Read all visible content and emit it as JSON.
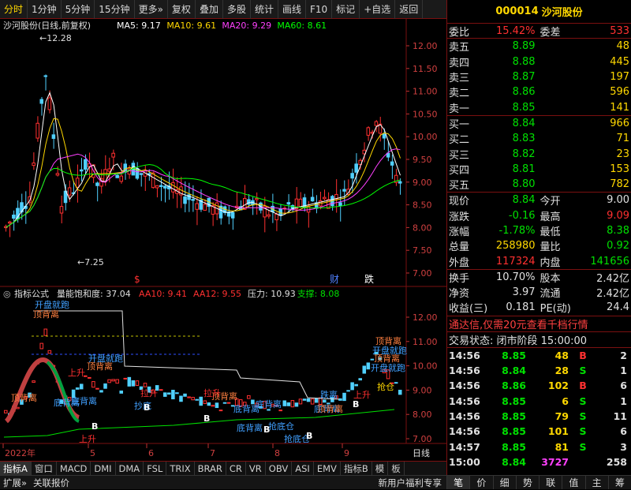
{
  "toolbar": {
    "items": [
      "分时",
      "1分钟",
      "5分钟",
      "15分钟",
      "更多»",
      "复权",
      "叠加",
      "多股",
      "统计",
      "画线",
      "F10",
      "标记",
      "+自选",
      "返回"
    ],
    "active": "分时"
  },
  "main_chart": {
    "title": "沙河股份(日线,前复权)",
    "ma_labels": [
      {
        "text": "MA5: 9.17",
        "color": "#ffffff"
      },
      {
        "text": "MA10: 9.61",
        "color": "#ffd800"
      },
      {
        "text": "MA20: 9.29",
        "color": "#ff40ff"
      },
      {
        "text": "MA60: 8.61",
        "color": "#00ff00"
      }
    ],
    "yaxis": [
      "12.00",
      "11.50",
      "11.00",
      "10.50",
      "10.00",
      "9.50",
      "9.00",
      "8.50",
      "8.00",
      "7.50",
      "7.00"
    ],
    "high_label": "←12.28",
    "low_label": "←7.25",
    "markers": [
      {
        "text": "$",
        "color": "#ff3030"
      },
      {
        "text": "财",
        "color": "#5080ff"
      },
      {
        "text": "跌",
        "color": "#ffffff"
      }
    ]
  },
  "indicator": {
    "name": "指标公式",
    "subtitle": "量能饱和度: 37.04",
    "values": [
      {
        "text": "AA10: 9.41",
        "color": "#ff3030"
      },
      {
        "text": "AA12: 9.55",
        "color": "#ff3030"
      },
      {
        "text": "压力: 10.93",
        "color": "#e0e0e0"
      },
      {
        "text": "支撑: 8.08",
        "color": "#00e000"
      }
    ],
    "yaxis": [
      "12.00",
      "11.00",
      "10.00",
      "9.00",
      "8.00",
      "7.00"
    ],
    "labels": [
      {
        "text": "顶背离",
        "color": "#ff8040"
      },
      {
        "text": "开盘就跑",
        "color": "#40a0ff"
      },
      {
        "text": "顶背离",
        "color": "#ff8040"
      },
      {
        "text": "开盘就跑",
        "color": "#40a0ff"
      },
      {
        "text": "上升",
        "color": "#ff3030"
      },
      {
        "text": "顶背离",
        "color": "#ff8040"
      },
      {
        "text": "底背离",
        "color": "#40a0ff"
      },
      {
        "text": "底背离",
        "color": "#40a0ff"
      },
      {
        "text": "拉升",
        "color": "#ff3030"
      },
      {
        "text": "抄底",
        "color": "#40a0ff"
      },
      {
        "text": "底背离",
        "color": "#40a0ff"
      },
      {
        "text": "抢底仓",
        "color": "#40a0ff"
      },
      {
        "text": "上升",
        "color": "#ff3030"
      },
      {
        "text": "顶背离",
        "color": "#ff8040"
      },
      {
        "text": "底背离",
        "color": "#40a0ff"
      },
      {
        "text": "跌离",
        "color": "#40a0ff"
      },
      {
        "text": "拉升",
        "color": "#ff3030"
      },
      {
        "text": "抢底仓",
        "color": "#40a0ff"
      },
      {
        "text": "顶背离",
        "color": "#ff8040"
      },
      {
        "text": "开盘就跑",
        "color": "#40a0ff"
      },
      {
        "text": "顶背离",
        "color": "#ff8040"
      },
      {
        "text": "开盘就跑",
        "color": "#40a0ff"
      },
      {
        "text": "上升",
        "color": "#ff3030"
      },
      {
        "text": "抢仓",
        "color": "#ffd800"
      },
      {
        "text": "底背离",
        "color": "#40a0ff"
      },
      {
        "text": "底背离",
        "color": "#40a0ff"
      },
      {
        "text": "顶背离",
        "color": "#ff8040"
      },
      {
        "text": "B",
        "color": "#ffffff"
      },
      {
        "text": "B",
        "color": "#ffffff"
      },
      {
        "text": "B",
        "color": "#ffffff"
      },
      {
        "text": "B",
        "color": "#ffffff"
      },
      {
        "text": "B",
        "color": "#ffffff"
      },
      {
        "text": "B",
        "color": "#ffffff"
      }
    ]
  },
  "date_axis": {
    "labels": [
      "2022年",
      "5",
      "6",
      "7",
      "8",
      "9"
    ],
    "period": "日线"
  },
  "bottom_tabs": [
    "指标A",
    "窗口",
    "MACD",
    "DMI",
    "DMA",
    "FSL",
    "TRIX",
    "BRAR",
    "CR",
    "VR",
    "OBV",
    "ASI",
    "EMV",
    "",
    "指标B",
    "模",
    "板"
  ],
  "status": {
    "left": [
      "扩展»",
      "关联报价"
    ],
    "right": "新用户福利专享"
  },
  "quote": {
    "code": "000014",
    "name": "沙河股份",
    "weibi": {
      "label": "委比",
      "value": "15.42%",
      "label2": "委差",
      "value2": "533"
    },
    "asks": [
      {
        "label": "卖五",
        "price": "8.89",
        "vol": "48"
      },
      {
        "label": "卖四",
        "price": "8.88",
        "vol": "445"
      },
      {
        "label": "卖三",
        "price": "8.87",
        "vol": "197"
      },
      {
        "label": "卖二",
        "price": "8.86",
        "vol": "596"
      },
      {
        "label": "卖一",
        "price": "8.85",
        "vol": "141"
      }
    ],
    "bids": [
      {
        "label": "买一",
        "price": "8.84",
        "vol": "966"
      },
      {
        "label": "买二",
        "price": "8.83",
        "vol": "71"
      },
      {
        "label": "买三",
        "price": "8.82",
        "vol": "23"
      },
      {
        "label": "买四",
        "price": "8.81",
        "vol": "153"
      },
      {
        "label": "买五",
        "price": "8.80",
        "vol": "782"
      }
    ],
    "stats1": [
      {
        "l": "现价",
        "v": "8.84",
        "vc": "#00e000",
        "l2": "今开",
        "v2": "9.00",
        "v2c": "#e0e0e0"
      },
      {
        "l": "涨跌",
        "v": "-0.16",
        "vc": "#00e000",
        "l2": "最高",
        "v2": "9.09",
        "v2c": "#ff3030"
      },
      {
        "l": "涨幅",
        "v": "-1.78%",
        "vc": "#00e000",
        "l2": "最低",
        "v2": "8.38",
        "v2c": "#00e000"
      },
      {
        "l": "总量",
        "v": "258980",
        "vc": "#ffd800",
        "l2": "量比",
        "v2": "0.92",
        "v2c": "#00e000"
      },
      {
        "l": "外盘",
        "v": "117324",
        "vc": "#ff3030",
        "l2": "内盘",
        "v2": "141656",
        "v2c": "#00e000"
      }
    ],
    "stats2": [
      {
        "l": "换手",
        "v": "10.70%",
        "l2": "股本",
        "v2": "2.42亿"
      },
      {
        "l": "净资",
        "v": "3.97",
        "l2": "流通",
        "v2": "2.42亿"
      },
      {
        "l": "收益(三)",
        "v": "0.181",
        "l2": "PE(动)",
        "v2": "24.4"
      }
    ],
    "banner": "通达信,仅需20元查看千档行情",
    "state": "交易状态: 闭市阶段 15:00:00",
    "ticks": [
      {
        "t": "14:56",
        "p": "8.85",
        "v": "48",
        "bs": "B",
        "n": "2"
      },
      {
        "t": "14:56",
        "p": "8.84",
        "v": "28",
        "bs": "S",
        "n": "1"
      },
      {
        "t": "14:56",
        "p": "8.86",
        "v": "102",
        "bs": "B",
        "n": "6"
      },
      {
        "t": "14:56",
        "p": "8.85",
        "v": "6",
        "bs": "S",
        "n": "1"
      },
      {
        "t": "14:56",
        "p": "8.85",
        "v": "79",
        "bs": "S",
        "n": "11"
      },
      {
        "t": "14:56",
        "p": "8.85",
        "v": "101",
        "bs": "S",
        "n": "6"
      },
      {
        "t": "14:57",
        "p": "8.85",
        "v": "81",
        "bs": "S",
        "n": "3"
      },
      {
        "t": "15:00",
        "p": "8.84",
        "v": "3727",
        "bs": "",
        "n": "258"
      }
    ],
    "tabs": [
      "笔",
      "价",
      "细",
      "势",
      "联",
      "值",
      "主",
      "筹"
    ]
  },
  "colors": {
    "up": "#ff3030",
    "down": "#00e000",
    "border": "#7a1010",
    "text": "#e0e0e0",
    "yellow": "#ffd800"
  }
}
